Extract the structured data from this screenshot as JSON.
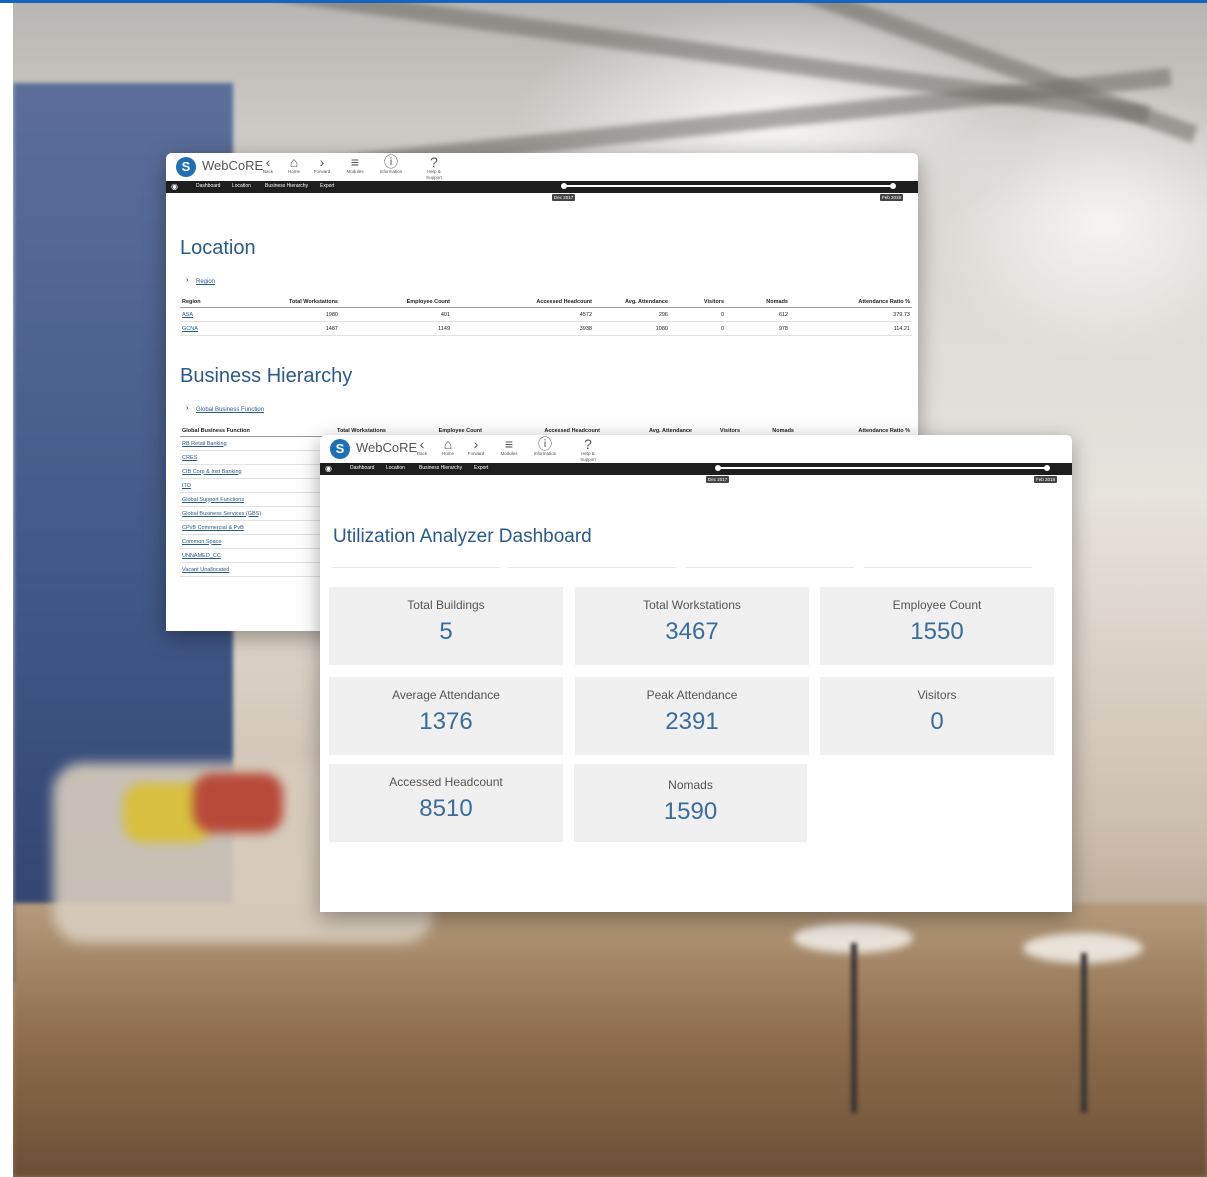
{
  "app": {
    "brand": "WebCoRE",
    "toolbar": [
      {
        "icon": "back-icon",
        "glyph": "‹",
        "label": "Back"
      },
      {
        "icon": "home-icon",
        "glyph": "⌂",
        "label": "Home"
      },
      {
        "icon": "forward-icon",
        "glyph": "›",
        "label": "Forward"
      },
      {
        "icon": "modules-icon",
        "glyph": "≡",
        "label": "Modules"
      },
      {
        "icon": "information-icon",
        "glyph": "ⓘ",
        "label": "Information"
      },
      {
        "icon": "help-icon",
        "glyph": "?",
        "label": "Help & Support"
      }
    ],
    "nav": [
      "Dashboard",
      "Location",
      "Business Hierarchy",
      "Export"
    ],
    "date_start": "Dec 2017",
    "date_end": "Feb 2018"
  },
  "location": {
    "title": "Location",
    "breadcrumb": "Region",
    "columns": [
      "Region",
      "Total Workstations",
      "Employee Count",
      "Accessed Headcount",
      "Avg. Attendance",
      "Visitors",
      "Nomads",
      "Attendance Ratio %"
    ],
    "rows": [
      [
        "ASA",
        "1980",
        "401",
        "4572",
        "296",
        "0",
        "612",
        "379.73"
      ],
      [
        "GCNA",
        "1487",
        "1149",
        "3938",
        "1080",
        "0",
        "978",
        "114.21"
      ]
    ]
  },
  "business": {
    "title": "Business Hierarchy",
    "breadcrumb": "Global Business Function",
    "columns": [
      "Global Business Function",
      "Total Workstations",
      "Employee Count",
      "Accessed Headcount",
      "Avg. Attendance",
      "Visitors",
      "Nomads",
      "Attendance Ratio %"
    ],
    "rows": [
      "RB Retail Banking",
      "CRES",
      "CIB Corp & Inst Banking",
      "ITO",
      "Global Support Functions",
      "Global Business Services (GBS)",
      "CPvB Commercial & PvB",
      "Common Space",
      "UNNAMED_CC",
      "Vacant Unallocated"
    ]
  },
  "dashboard": {
    "title": "Utilization Analyzer Dashboard",
    "tiles": [
      {
        "label": "Total Buildings",
        "value": "5"
      },
      {
        "label": "Total Workstations",
        "value": "3467"
      },
      {
        "label": "Employee Count",
        "value": "1550"
      },
      {
        "label": "Average Attendance",
        "value": "1376"
      },
      {
        "label": "Peak Attendance",
        "value": "2391"
      },
      {
        "label": "Visitors",
        "value": "0"
      },
      {
        "label": "Accessed Headcount",
        "value": "8510"
      },
      {
        "label": "Nomads",
        "value": "1590"
      }
    ]
  },
  "colors": {
    "accent": "#2a5a8a",
    "nav_bar": "#1e1e1e",
    "logo": "#1f6fb5",
    "tile_bg": "#f0f0f0"
  }
}
